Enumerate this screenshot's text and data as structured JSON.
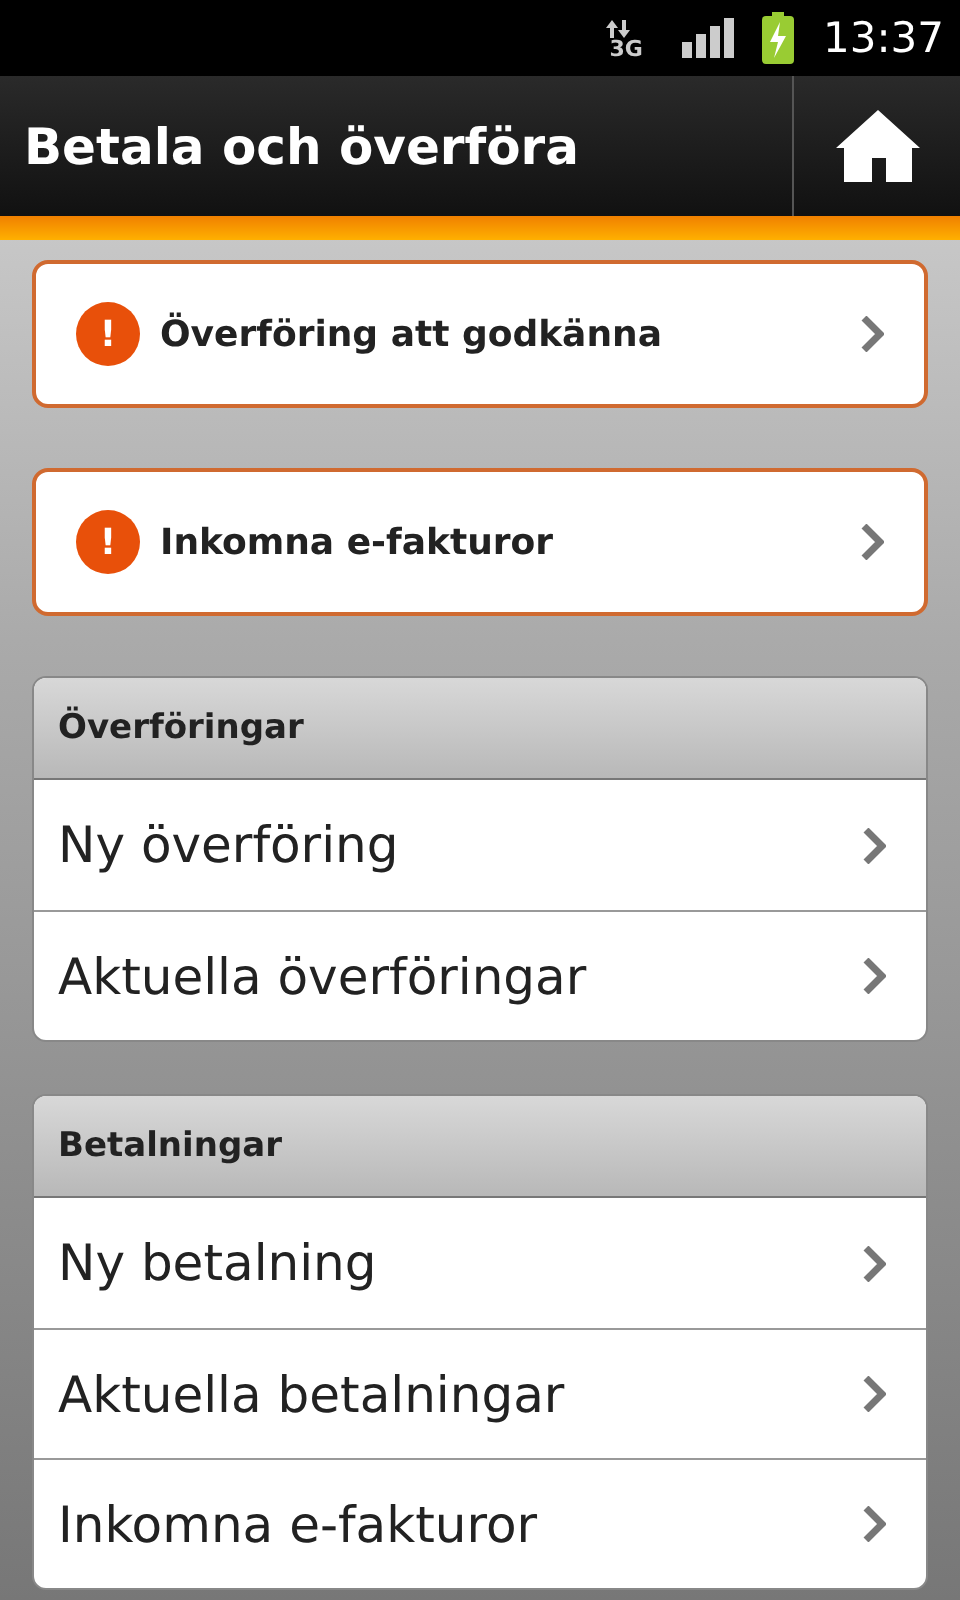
{
  "status_bar": {
    "network": "3G",
    "time": "13:37"
  },
  "header": {
    "title": "Betala och överföra"
  },
  "alerts": [
    {
      "label": "Överföring att godkänna",
      "icon": "!"
    },
    {
      "label": "Inkomna e-fakturor",
      "icon": "!"
    }
  ],
  "sections": [
    {
      "title": "Överföringar",
      "items": [
        "Ny överföring",
        "Aktuella överföringar"
      ]
    },
    {
      "title": "Betalningar",
      "items": [
        "Ny betalning",
        "Aktuella betalningar",
        "Inkomna e-fakturor"
      ]
    }
  ]
}
